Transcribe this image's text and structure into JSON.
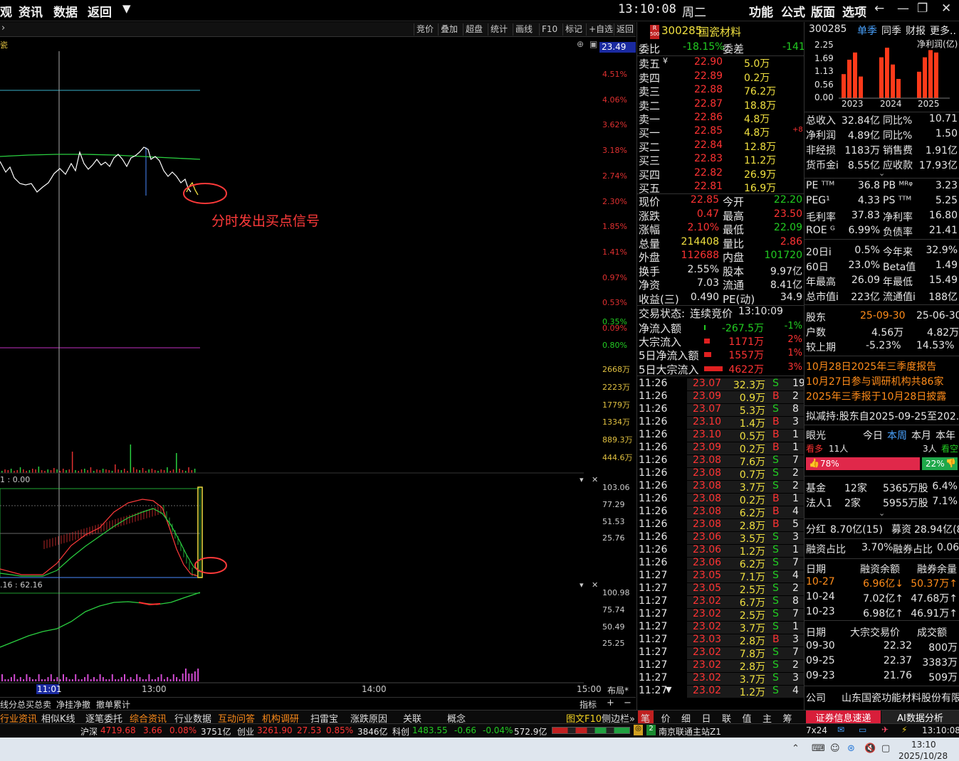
{
  "menu": [
    "观",
    "资讯",
    "数据",
    "返回",
    "▼"
  ],
  "clock": "13:10:08",
  "weekday": "周二",
  "topright": [
    "功能",
    "公式",
    "版面",
    "选项"
  ],
  "toolbar": [
    "竞价",
    "叠加",
    "超盘",
    "统计",
    "画线",
    "F10",
    "标记",
    "+自选",
    "返回"
  ],
  "chart": {
    "price_current": "23.49",
    "pct_ticks": [
      "4.51%",
      "4.06%",
      "3.62%",
      "3.18%",
      "2.74%",
      "2.30%",
      "1.85%",
      "1.41%",
      "0.97%",
      "0.53%",
      "0.09%",
      "0.35%",
      "0.80%"
    ],
    "vol_ticks": [
      "2668万",
      "2223万",
      "1779万",
      "1334万",
      "889.3万",
      "444.6万"
    ],
    "ind1_ticks": [
      "103.06",
      "77.29",
      "51.53",
      "25.76"
    ],
    "ind2_ticks": [
      "100.98",
      "75.74",
      "50.49",
      "25.25"
    ],
    "ind1_label": "1 : 0.00",
    "ind2_label": ".16 : 62.16",
    "time_ticks": [
      "11:01",
      "13:00",
      "14:00",
      "15:00"
    ],
    "layout_label": "布局*",
    "annotation": "分时发出买点信号",
    "indicator_btn": "指标"
  },
  "stock": {
    "code": "300285",
    "name": "国瓷材料",
    "badge_top": "R",
    "badge_bottom": "500"
  },
  "weibi": {
    "label": "委比",
    "value": "-18.15%",
    "diff_label": "委差",
    "diff": "-141"
  },
  "asks": [
    {
      "label": "卖五",
      "price": "22.90",
      "vol": "5.0万"
    },
    {
      "label": "卖四",
      "price": "22.89",
      "vol": "0.2万"
    },
    {
      "label": "卖三",
      "price": "22.88",
      "vol": "76.2万"
    },
    {
      "label": "卖二",
      "price": "22.87",
      "vol": "18.8万"
    },
    {
      "label": "卖一",
      "price": "22.86",
      "vol": "4.8万"
    }
  ],
  "bids": [
    {
      "label": "买一",
      "price": "22.85",
      "vol": "4.8万",
      "chg": "+8"
    },
    {
      "label": "买二",
      "price": "22.84",
      "vol": "12.8万",
      "chg": ""
    },
    {
      "label": "买三",
      "price": "22.83",
      "vol": "11.2万",
      "chg": ""
    },
    {
      "label": "买四",
      "price": "22.82",
      "vol": "26.9万",
      "chg": ""
    },
    {
      "label": "买五",
      "price": "22.81",
      "vol": "16.9万",
      "chg": ""
    }
  ],
  "quote": [
    {
      "l1": "现价",
      "v1": "22.85",
      "l2": "今开",
      "v2": "22.20"
    },
    {
      "l1": "涨跌",
      "v1": "0.47",
      "l2": "最高",
      "v2": "23.50"
    },
    {
      "l1": "涨幅",
      "v1": "2.10%",
      "l2": "最低",
      "v2": "22.09"
    },
    {
      "l1": "总量",
      "v1": "214408",
      "l2": "量比",
      "v2": "2.86"
    },
    {
      "l1": "外盘",
      "v1": "112688",
      "l2": "内盘",
      "v2": "101720"
    },
    {
      "l1": "换手",
      "v1": "2.55%",
      "l2": "股本",
      "v2": "9.97亿"
    },
    {
      "l1": "净资",
      "v1": "7.03",
      "l2": "流通",
      "v2": "8.41亿"
    },
    {
      "l1": "收益(三)",
      "v1": "0.490",
      "l2": "PE(动)",
      "v2": "34.9"
    }
  ],
  "trade_state": {
    "label": "交易状态:",
    "value": "连续竞价",
    "time": "13:10:09"
  },
  "flows": [
    {
      "label": "净流入额",
      "value": "-267.5万",
      "pct": "-1%"
    },
    {
      "label": "大宗流入",
      "value": "1171万",
      "pct": "2%"
    },
    {
      "label": "5日净流入额",
      "value": "1557万",
      "pct": "1%"
    },
    {
      "label": "5日大宗流入",
      "value": "4622万",
      "pct": "3%"
    }
  ],
  "ticks": [
    [
      "11:26",
      "23.07",
      "32.3万",
      "S",
      "19"
    ],
    [
      "11:26",
      "23.09",
      "0.9万",
      "B",
      "2"
    ],
    [
      "11:26",
      "23.07",
      "5.3万",
      "S",
      "8"
    ],
    [
      "11:26",
      "23.10",
      "1.4万",
      "B",
      "3"
    ],
    [
      "11:26",
      "23.10",
      "0.5万",
      "B",
      "1"
    ],
    [
      "11:26",
      "23.09",
      "0.2万",
      "B",
      "1"
    ],
    [
      "11:26",
      "23.08",
      "7.6万",
      "S",
      "7"
    ],
    [
      "11:26",
      "23.08",
      "0.7万",
      "S",
      "2"
    ],
    [
      "11:26",
      "23.08",
      "3.7万",
      "S",
      "2"
    ],
    [
      "11:26",
      "23.08",
      "0.2万",
      "B",
      "1"
    ],
    [
      "11:26",
      "23.08",
      "6.2万",
      "B",
      "4"
    ],
    [
      "11:26",
      "23.08",
      "2.8万",
      "B",
      "5"
    ],
    [
      "11:26",
      "23.06",
      "3.5万",
      "S",
      "3"
    ],
    [
      "11:26",
      "23.06",
      "1.2万",
      "S",
      "1"
    ],
    [
      "11:26",
      "23.06",
      "6.2万",
      "S",
      "7"
    ],
    [
      "11:27",
      "23.05",
      "7.1万",
      "S",
      "4"
    ],
    [
      "11:27",
      "23.05",
      "2.5万",
      "S",
      "2"
    ],
    [
      "11:27",
      "23.02",
      "6.7万",
      "S",
      "8"
    ],
    [
      "11:27",
      "23.02",
      "2.5万",
      "S",
      "7"
    ],
    [
      "11:27",
      "23.02",
      "3.7万",
      "S",
      "1"
    ],
    [
      "11:27",
      "23.03",
      "2.8万",
      "B",
      "3"
    ],
    [
      "11:27",
      "23.02",
      "7.8万",
      "S",
      "7"
    ],
    [
      "11:27",
      "23.02",
      "2.8万",
      "S",
      "2"
    ],
    [
      "11:27",
      "23.02",
      "3.7万",
      "S",
      "3"
    ],
    [
      "11:27",
      "23.02",
      "1.2万",
      "S",
      "4"
    ]
  ],
  "f10": {
    "code": "300285",
    "tabs": [
      "单季",
      "同季",
      "财报",
      "更多.."
    ],
    "chart_title": "净利润(亿)",
    "y_ticks": [
      "2.25",
      "1.69",
      "1.13",
      "0.56",
      "0.00"
    ],
    "years": [
      "2023",
      "2024",
      "2025"
    ],
    "metrics": [
      {
        "l1": "总收入",
        "v1": "32.84亿",
        "l2": "同比%",
        "v2": "10.71"
      },
      {
        "l1": "净利润",
        "v1": "4.89亿",
        "l2": "同比%",
        "v2": "1.50"
      },
      {
        "l1": "非经损",
        "v1": "1183万",
        "l2": "销售费",
        "v2": "1.91亿"
      },
      {
        "l1": "货币金i",
        "v1": "8.55亿",
        "l2": "应收款",
        "v2": "17.93亿"
      }
    ],
    "val": [
      {
        "l1": "PE ᵀᵀᴹ",
        "v1": "36.8",
        "l2": "PB ᴹᴿᵠ",
        "v2": "3.23"
      },
      {
        "l1": "PEG¹",
        "v1": "4.33",
        "l2": "PS ᵀᵀᴹ",
        "v2": "5.25"
      },
      {
        "l1": "毛利率",
        "v1": "37.83",
        "l2": "净利率",
        "v2": "16.80"
      },
      {
        "l1": "ROE ᴳ",
        "v1": "6.99%",
        "l2": "负债率",
        "v2": "21.41"
      }
    ],
    "perf": [
      {
        "l1": "20日i",
        "v1": "0.5%",
        "l2": "今年来",
        "v2": "32.9%"
      },
      {
        "l1": "60日",
        "v1": "23.0%",
        "l2": "Beta值",
        "v2": "1.49"
      },
      {
        "l1": "年最高",
        "v1": "26.09",
        "l2": "年最低",
        "v2": "15.49"
      },
      {
        "l1": "总市值i",
        "v1": "223亿",
        "l2": "流通值i",
        "v2": "188亿"
      }
    ],
    "holders": {
      "label": "股东",
      "d1": "25-09-30",
      "d2": "25-06-30",
      "r1l": "户数",
      "r1a": "4.56万",
      "r1b": "4.82万",
      "r2l": "较上期",
      "r2a": "-5.23%",
      "r2b": "14.53%"
    },
    "news": [
      "10月28日2025年三季度报告",
      "10月27日参与调研机构共86家",
      "2025年三季报于10月28日披露",
      "拟减持:股东自2025-09-25至202..."
    ],
    "yanguang": {
      "label": "眼光",
      "tabs": [
        "今日",
        "本周",
        "本月",
        "本年"
      ],
      "bull": "看多",
      "bull_n": "11人",
      "bear_n": "3人",
      "bear": "看空",
      "bull_pct": "78%",
      "bear_pct": "22%"
    },
    "inst": [
      {
        "l": "基金",
        "a": "12家",
        "b": "5365万股",
        "c": "6.4%"
      },
      {
        "l": "法人1",
        "a": "2家",
        "b": "5955万股",
        "c": "7.1%"
      }
    ],
    "div": {
      "l1": "分红",
      "v1": "8.70亿(15)",
      "l2": "募资",
      "v2": "28.94亿(8)"
    },
    "margin": {
      "l1": "融资占比",
      "v1": "3.70%",
      "l2": "融券占比",
      "v2": "0.06%"
    },
    "mtable_head": [
      "日期",
      "融资余额",
      "融券余量"
    ],
    "mtable": [
      [
        "10-27",
        "6.96亿↓",
        "50.37万↑"
      ],
      [
        "10-24",
        "7.02亿↑",
        "47.68万↑"
      ],
      [
        "10-23",
        "6.98亿↑",
        "46.91万↑"
      ]
    ],
    "btable_head": [
      "日期",
      "大宗交易价",
      "成交额"
    ],
    "btable": [
      [
        "09-30",
        "22.32",
        "800万"
      ],
      [
        "09-25",
        "22.37",
        "3383万"
      ],
      [
        "09-23",
        "21.76",
        "509万"
      ]
    ],
    "company_label": "公司",
    "company": "山东国瓷功能材料股份有限...",
    "btns": [
      "证券信息速递",
      "AI数据分析"
    ]
  },
  "bottom_tabs": [
    "行业资讯",
    "相似K线",
    "逐笔委托",
    "综合资讯",
    "行业数据",
    "互动问答",
    "机构调研",
    "扫雷宝",
    "涨跌原因",
    "关联",
    "概念",
    "图文F10",
    "侧边栏»"
  ],
  "sub_tabs": [
    "线分",
    "总买总卖",
    "净挂净撤",
    "撤单累计"
  ],
  "right_tabs": [
    "笔",
    "价",
    "细",
    "日",
    "联",
    "值",
    "主",
    "筹"
  ],
  "status": {
    "sh": {
      "name": "沪深",
      "v": "4719.68",
      "c": "3.66",
      "p": "0.08%",
      "a": "3751亿"
    },
    "cy": {
      "name": "创业",
      "v": "3261.90",
      "c": "27.53",
      "p": "0.85%",
      "a": "3846亿"
    },
    "kc": {
      "name": "科创",
      "v": "1483.55",
      "c": "-0.66",
      "p": "-0.04%",
      "a": "572.9亿"
    },
    "server": "南京联通主站Z1",
    "mode": "7x24",
    "time": "13:10:08"
  },
  "taskbar": {
    "time": "13:10",
    "date": "2025/10/28"
  }
}
